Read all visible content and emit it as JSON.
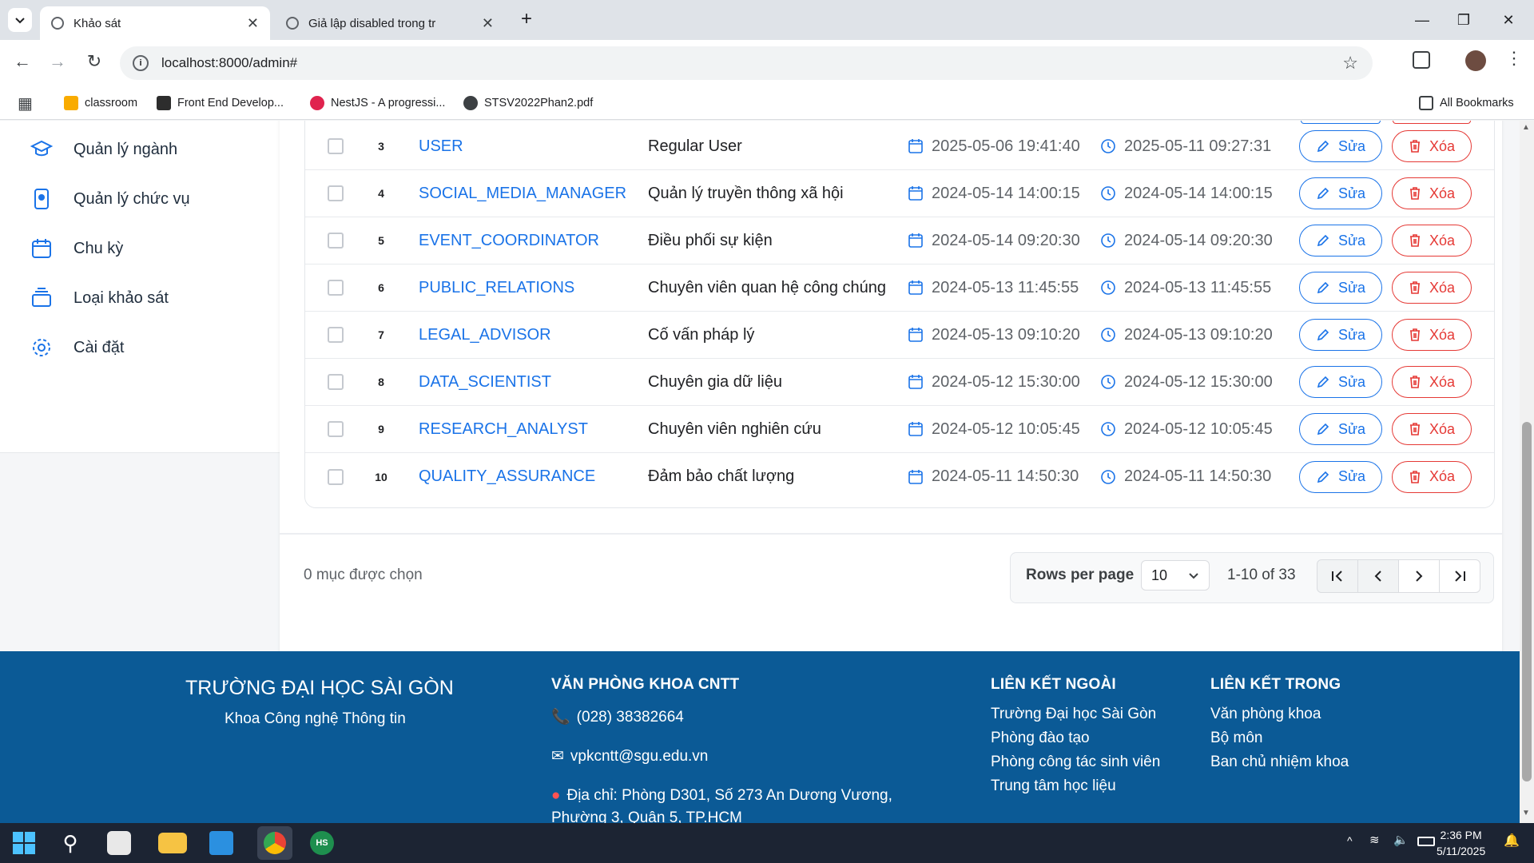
{
  "browser": {
    "tabs": [
      {
        "title": "Khảo sát",
        "active": true
      },
      {
        "title": "Giả lập disabled trong tr",
        "active": false
      }
    ],
    "url": "localhost:8000/admin#",
    "bookmarks": [
      "classroom",
      "Front End Develop...",
      "NestJS - A progressi...",
      "STSV2022Phan2.pdf"
    ],
    "all_bookmarks": "All Bookmarks"
  },
  "sidebar": {
    "items": [
      {
        "label": "Quản lý ngành",
        "icon": "graduation-cap-icon"
      },
      {
        "label": "Quản lý chức vụ",
        "icon": "badge-icon"
      },
      {
        "label": "Chu kỳ",
        "icon": "calendar-icon"
      },
      {
        "label": "Loại khảo sát",
        "icon": "stack-icon"
      },
      {
        "label": "Cài đặt",
        "icon": "gear-icon"
      }
    ]
  },
  "table": {
    "rows": [
      {
        "index": "3",
        "code": "USER",
        "name": "Regular User",
        "created": "2025-05-06 19:41:40",
        "updated": "2025-05-11 09:27:31"
      },
      {
        "index": "4",
        "code": "SOCIAL_MEDIA_MANAGER",
        "name": "Quản lý truyền thông xã hội",
        "created": "2024-05-14 14:00:15",
        "updated": "2024-05-14 14:00:15"
      },
      {
        "index": "5",
        "code": "EVENT_COORDINATOR",
        "name": "Điều phối sự kiện",
        "created": "2024-05-14 09:20:30",
        "updated": "2024-05-14 09:20:30"
      },
      {
        "index": "6",
        "code": "PUBLIC_RELATIONS",
        "name": "Chuyên viên quan hệ công chúng",
        "created": "2024-05-13 11:45:55",
        "updated": "2024-05-13 11:45:55"
      },
      {
        "index": "7",
        "code": "LEGAL_ADVISOR",
        "name": "Cố vấn pháp lý",
        "created": "2024-05-13 09:10:20",
        "updated": "2024-05-13 09:10:20"
      },
      {
        "index": "8",
        "code": "DATA_SCIENTIST",
        "name": "Chuyên gia dữ liệu",
        "created": "2024-05-12 15:30:00",
        "updated": "2024-05-12 15:30:00"
      },
      {
        "index": "9",
        "code": "RESEARCH_ANALYST",
        "name": "Chuyên viên nghiên cứu",
        "created": "2024-05-12 10:05:45",
        "updated": "2024-05-12 10:05:45"
      },
      {
        "index": "10",
        "code": "QUALITY_ASSURANCE",
        "name": "Đảm bảo chất lượng",
        "created": "2024-05-11 14:50:30",
        "updated": "2024-05-11 14:50:30"
      }
    ],
    "edit_label": "Sửa",
    "delete_label": "Xóa"
  },
  "pagination": {
    "selected_text": "0 mục được chọn",
    "rows_per_page_label": "Rows per page",
    "rows_per_page": "10",
    "range": "1-10 of 33"
  },
  "footer": {
    "school": "TRƯỜNG ĐẠI HỌC SÀI GÒN",
    "faculty": "Khoa Công nghệ Thông tin",
    "office_heading": "VĂN PHÒNG KHOA CNTT",
    "phone": "(028) 38382664",
    "email": "vpkcntt@sgu.edu.vn",
    "address_line1": "Địa chỉ: Phòng D301, Số 273 An Dương Vương,",
    "address_line2": "Phường 3, Quận 5, TP.HCM",
    "external_heading": "LIÊN KẾT NGOÀI",
    "external_links": [
      "Trường Đại học Sài Gòn",
      "Phòng đào tạo",
      "Phòng công tác sinh viên",
      "Trung tâm học liệu"
    ],
    "internal_heading": "LIÊN KẾT TRONG",
    "internal_links": [
      "Văn phòng khoa",
      "Bộ môn",
      "Ban chủ nhiệm khoa"
    ]
  },
  "taskbar": {
    "time": "2:36 PM",
    "date": "5/11/2025"
  }
}
